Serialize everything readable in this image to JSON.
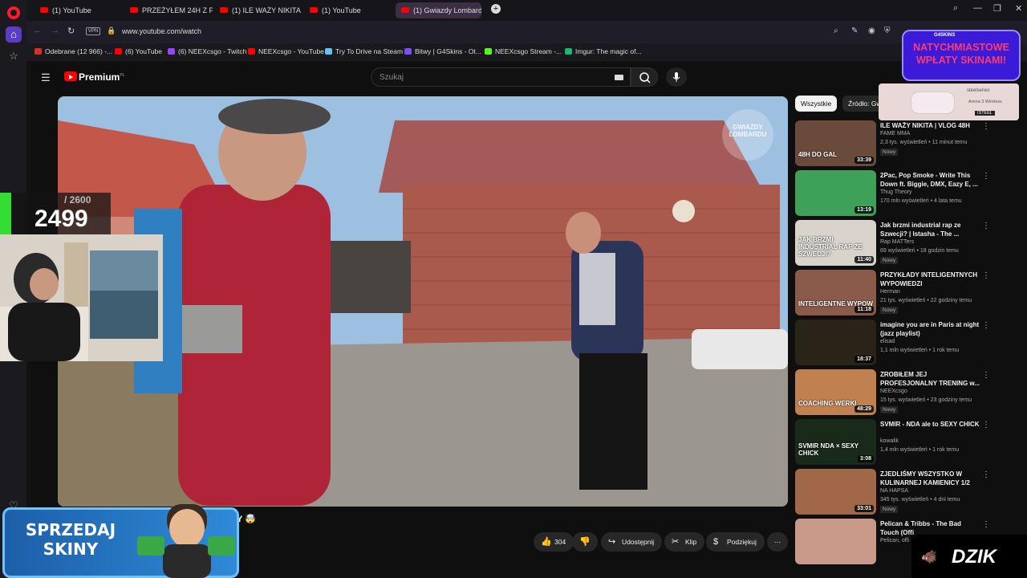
{
  "browser": {
    "tabs": [
      {
        "label": "(1) YouTube"
      },
      {
        "label": "PRZEŻYŁEM 24H Z POLICJ"
      },
      {
        "label": "(1) ILE WAŻY NIKITA | VLO"
      },
      {
        "label": "(1) YouTube"
      },
      {
        "label": "(1) Gwiazdy Lombardu: G"
      }
    ],
    "vpn_badge": "VPN",
    "url": "www.youtube.com/watch",
    "bookmarks": [
      {
        "label": "Odebrane (12 966) -...",
        "color": "#d93025"
      },
      {
        "label": "(6) YouTube",
        "color": "#ff0000"
      },
      {
        "label": "(6) NEEXcsgo - Twitch",
        "color": "#9146ff"
      },
      {
        "label": "NEEXcsgo - YouTube",
        "color": "#ff0000"
      },
      {
        "label": "Try To Drive na Steam",
        "color": "#66c0f4"
      },
      {
        "label": "Bitwy | G4Skins - Ot...",
        "color": "#7c4dff"
      },
      {
        "label": "NEEXcsgo Stream -...",
        "color": "#53fc18"
      },
      {
        "label": "Imgur: The magic of...",
        "color": "#1bb76e"
      }
    ]
  },
  "youtube": {
    "brand": "Premium",
    "brand_region": "PL",
    "search_placeholder": "Szukaj",
    "video": {
      "watermark_line1": "GWIAZDY",
      "watermark_line2": "LOMBARDU",
      "title_fragment": "Y 🤯"
    },
    "actions": {
      "likes": "304",
      "share": "Udostępnij",
      "clip": "Klip",
      "thanks": "Podziękuj"
    },
    "chips": [
      "Wszystkie",
      "Źródło: Gw"
    ],
    "recommendations": [
      {
        "title": "ILE WAŻY NIKITA | VLOG 48H",
        "channel": "FAME MMA",
        "meta": "2,3 tys. wyświetleń • 11 minut temu",
        "new": "Nowy",
        "duration": "33:39",
        "thumb": "48H DO GAL",
        "bg": "#6a4a3a"
      },
      {
        "title": "2Pac, Pop Smoke - Write This Down ft. Biggie, DMX, Eazy E, ...",
        "channel": "Thug Theory",
        "meta": "170 mln wyświetleń • 4 lata temu",
        "new": "",
        "duration": "13:19",
        "thumb": "",
        "bg": "#3fa05a"
      },
      {
        "title": "Jak brzmi industrial rap ze Szwecji? | Istasha - The ...",
        "channel": "Rap MATTers",
        "meta": "89 wyświetleń • 18 godzin temu",
        "new": "Nowy",
        "duration": "11:40",
        "thumb": "JAK BRZMI INDUSTRIAL RAP ZE SZWECJI?",
        "bg": "#d8d4cc"
      },
      {
        "title": "PRZYKŁADY INTELIGENTNYCH WYPOWIEDZI",
        "channel": "Herman",
        "meta": "21 tys. wyświetleń • 22 godziny temu",
        "new": "Nowy",
        "duration": "11:18",
        "thumb": "INTELIGENTNE WYPOW",
        "bg": "#8a5a4a"
      },
      {
        "title": "imagine you are in Paris at night (jazz playlist)",
        "channel": "elisad",
        "meta": "1,1 mln wyświetleń • 1 rok temu",
        "new": "",
        "duration": "18:37",
        "thumb": "",
        "bg": "#2a2418"
      },
      {
        "title": "ZROBIŁEM JEJ PROFESJONALNY TRENING w...",
        "channel": "NEEXcsgo",
        "meta": "15 tys. wyświetleń • 23 godziny temu",
        "new": "Nowy",
        "duration": "48:29",
        "thumb": "COACHING WERKI",
        "bg": "#c08050"
      },
      {
        "title": "SVMIR - NDA ale to SEXY CHICK",
        "channel": "kowalik",
        "meta": "1,4 mln wyświetleń • 1 rok temu",
        "new": "",
        "duration": "3:08",
        "thumb": "SVMIR NDA × SEXY CHICK",
        "bg": "#1a2a1a"
      },
      {
        "title": "ZJEDLIŚMY WSZYSTKO W KULINARNEJ KAMIENICY 1/2",
        "channel": "NA HAPSA",
        "meta": "345 tys. wyświetleń • 4 dni temu",
        "new": "Nowy",
        "duration": "33:01",
        "thumb": "",
        "bg": "#a06848"
      },
      {
        "title": "Pelican & Tribbs - The Bad Touch (Offi",
        "channel": "Pelican, offi",
        "meta": "",
        "new": "",
        "duration": "",
        "thumb": "",
        "bg": "#c89888"
      }
    ]
  },
  "overlays": {
    "counter_goal": "/ 2600",
    "counter_value": "2499",
    "sprzedaj_line1": "SPRZEDAJ",
    "sprzedaj_line2": "SKINY",
    "natych_brand": "G4SKINS",
    "natych_line1": "NATYCHMIASTOWE",
    "natych_line2": "WPŁATY SKINAMI!",
    "steelseries": "steelseries",
    "arena": "Arena 3 Wireless",
    "steel_tag": "ISTEEL",
    "dzik": "DZIK"
  },
  "colors": {
    "accent": "#ff0000",
    "opera": "#ff1b2d",
    "natych_bg": "#3b1bd8",
    "natych_text": "#ff3b6b"
  }
}
